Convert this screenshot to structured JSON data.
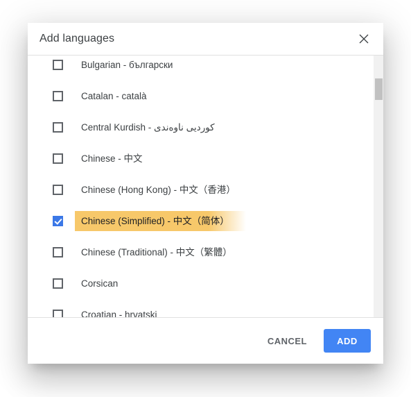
{
  "dialog": {
    "title": "Add languages",
    "close_icon": "close-icon",
    "languages": [
      {
        "label": "Bulgarian - български",
        "checked": false,
        "highlighted": false
      },
      {
        "label": "Catalan - català",
        "checked": false,
        "highlighted": false
      },
      {
        "label": "Central Kurdish - کوردیی ناوەندی",
        "checked": false,
        "highlighted": false
      },
      {
        "label": "Chinese - 中文",
        "checked": false,
        "highlighted": false
      },
      {
        "label": "Chinese (Hong Kong) - 中文（香港）",
        "checked": false,
        "highlighted": false
      },
      {
        "label": "Chinese (Simplified) - 中文（简体）",
        "checked": true,
        "highlighted": true
      },
      {
        "label": "Chinese (Traditional) - 中文（繁體）",
        "checked": false,
        "highlighted": false
      },
      {
        "label": "Corsican",
        "checked": false,
        "highlighted": false
      },
      {
        "label": "Croatian - hrvatski",
        "checked": false,
        "highlighted": false
      }
    ],
    "footer": {
      "cancel_label": "CANCEL",
      "add_label": "ADD"
    },
    "colors": {
      "accent_blue": "#4285f4",
      "checkbox_checked": "#3b78e7",
      "highlight_amber": "#f7c86a",
      "text_primary": "#3c4043",
      "scrollbar_thumb": "#c1c1c1",
      "scrollbar_track": "#f1f1f1"
    }
  }
}
